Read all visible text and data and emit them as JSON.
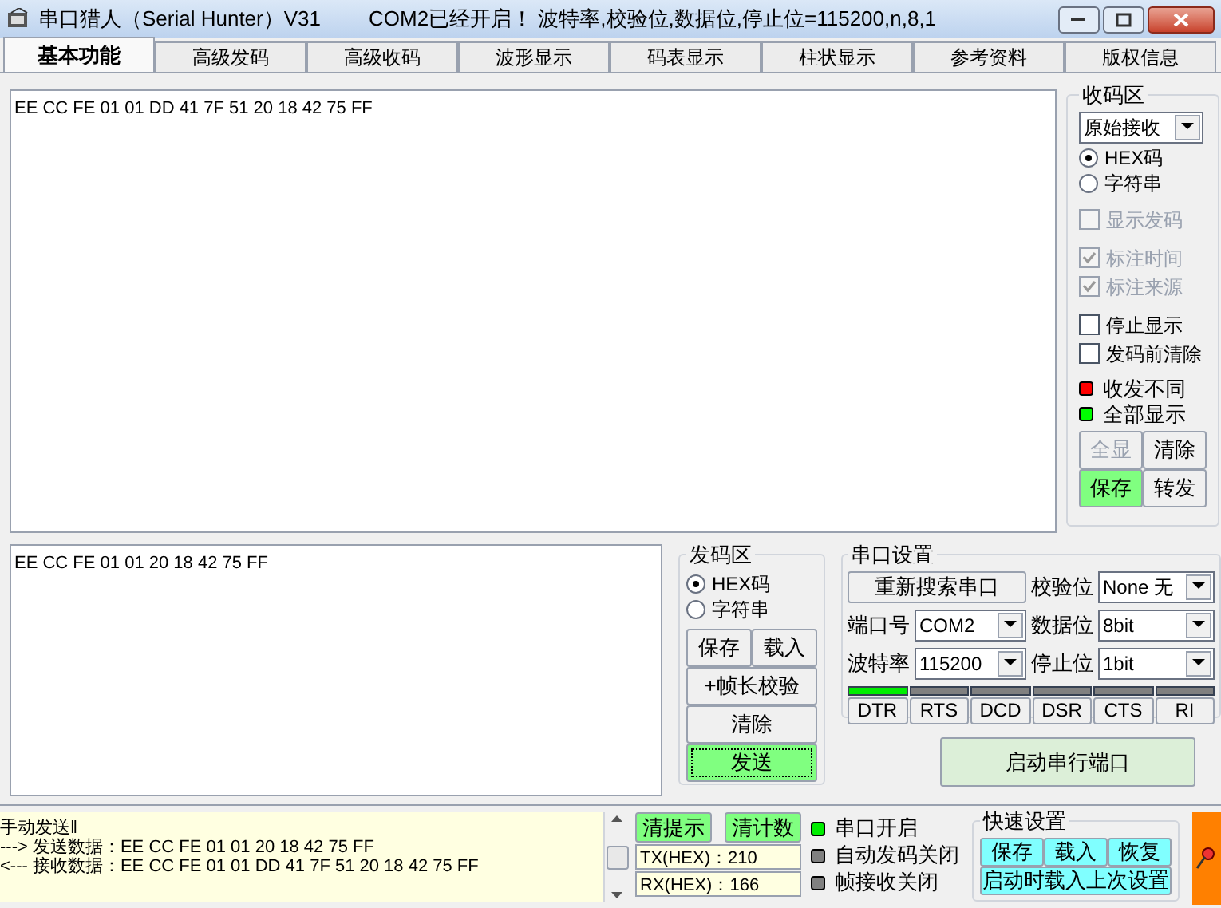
{
  "window": {
    "title": "串口猎人（Serial Hunter）V31",
    "status": "COM2已经开启！ 波特率,校验位,数据位,停止位=115200,n,8,1"
  },
  "tabs": [
    {
      "label": "基本功能",
      "selected": true
    },
    {
      "label": "高级发码",
      "selected": false
    },
    {
      "label": "高级收码",
      "selected": false
    },
    {
      "label": "波形显示",
      "selected": false
    },
    {
      "label": "码表显示",
      "selected": false
    },
    {
      "label": "柱状显示",
      "selected": false
    },
    {
      "label": "参考资料",
      "selected": false
    },
    {
      "label": "版权信息",
      "selected": false
    }
  ],
  "receive_area": {
    "text": "EE CC FE 01 01 DD 41 7F 51 20 18 42 75 FF"
  },
  "receive_panel": {
    "title": "收码区",
    "mode": "原始接收",
    "radios": [
      {
        "label": "HEX码",
        "selected": true
      },
      {
        "label": "字符串",
        "selected": false
      }
    ],
    "checkbox_groups": [
      [
        {
          "label": "显示发码",
          "checked": false,
          "disabled": true
        }
      ],
      [
        {
          "label": "标注时间",
          "checked": true,
          "disabled": true
        },
        {
          "label": "标注来源",
          "checked": true,
          "disabled": true
        }
      ],
      [
        {
          "label": "停止显示",
          "checked": false,
          "disabled": false
        },
        {
          "label": "发码前清除",
          "checked": false,
          "disabled": false
        }
      ]
    ],
    "indicators": [
      {
        "label": "收发不同",
        "color": "#ff0000"
      },
      {
        "label": "全部显示",
        "color": "#00ff00"
      }
    ],
    "buttons": [
      {
        "label": "全显",
        "disabled": true,
        "highlighted": false
      },
      {
        "label": "清除",
        "disabled": false,
        "highlighted": false
      },
      {
        "label": "保存",
        "disabled": false,
        "highlighted": true
      },
      {
        "label": "转发",
        "disabled": false,
        "highlighted": false
      }
    ]
  },
  "send_area": {
    "text": "EE CC FE 01 01 20 18 42 75 FF"
  },
  "send_panel": {
    "title": "发码区",
    "radios": [
      {
        "label": "HEX码",
        "selected": true
      },
      {
        "label": "字符串",
        "selected": false
      }
    ],
    "button_rows": [
      [
        {
          "label": "保存",
          "highlighted": false
        },
        {
          "label": "载入",
          "highlighted": false
        }
      ],
      [
        {
          "label": "+帧长校验",
          "highlighted": false
        }
      ],
      [
        {
          "label": "清除",
          "highlighted": false
        }
      ],
      [
        {
          "label": "发送",
          "highlighted": true
        }
      ]
    ]
  },
  "serial_settings": {
    "title": "串口设置",
    "rescan_button": "重新搜索串口",
    "fields": [
      {
        "label": "校验位",
        "value": "None 无"
      },
      {
        "label": "端口号",
        "value": "COM2"
      },
      {
        "label": "数据位",
        "value": "8bit"
      },
      {
        "label": "波特率",
        "value": "115200"
      },
      {
        "label": "停止位",
        "value": "1bit"
      }
    ],
    "signals": [
      {
        "label": "DTR",
        "on": true
      },
      {
        "label": "RTS",
        "on": false
      },
      {
        "label": "DCD",
        "on": false
      },
      {
        "label": "DSR",
        "on": false
      },
      {
        "label": "CTS",
        "on": false
      },
      {
        "label": "RI",
        "on": false
      }
    ]
  },
  "start_button": "启动串行端口",
  "log": {
    "lines": [
      "手动发送‖",
      "---> 发送数据：EE CC FE 01 01 20 18 42 75 FF",
      "<--- 接收数据：EE CC FE 01 01 DD 41 7F 51 20 18 42 75 FF"
    ]
  },
  "counters": {
    "buttons": [
      "清提示",
      "清计数"
    ],
    "readings": [
      "TX(HEX)：210",
      "RX(HEX)：166"
    ]
  },
  "status_lights": [
    {
      "label": "串口开启",
      "color": "#00ee00"
    },
    {
      "label": "自动发码关闭",
      "color": "#808080"
    },
    {
      "label": "帧接收关闭",
      "color": "#808080"
    }
  ],
  "quick_settings": {
    "title": "快速设置",
    "buttons": [
      "保存",
      "载入",
      "恢复"
    ],
    "wide_button": "启动时载入上次设置"
  }
}
